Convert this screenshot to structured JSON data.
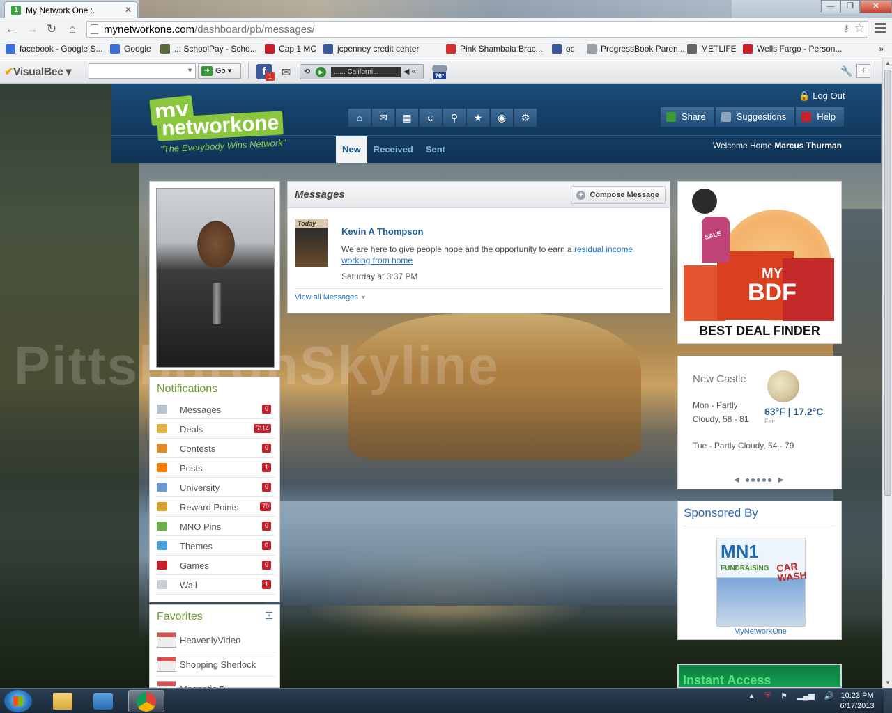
{
  "browser": {
    "tab_title": "My Network One :.",
    "tab_close": "✕",
    "window_controls": {
      "minimize": "—",
      "maximize": "❐",
      "close": "✕"
    },
    "url_host": "mynetworkone.com",
    "url_path": "/dashboard/pb/messages/",
    "nav": {
      "back": "←",
      "forward": "→",
      "reload": "↻",
      "home": "⌂"
    }
  },
  "bookmarks": {
    "items": [
      {
        "label": "facebook - Google S...",
        "icon": "google-icon",
        "color": "#3b6fd6"
      },
      {
        "label": "Google",
        "icon": "google-icon",
        "color": "#3b6fd6"
      },
      {
        "label": ".:: SchoolPay - Scho...",
        "icon": "turtle-icon",
        "color": "#5a6b3a"
      },
      {
        "label": "Cap 1 MC",
        "icon": "capitalone-icon",
        "color": "#c8202a"
      },
      {
        "label": "jcpenney credit center",
        "icon": "facebook-icon",
        "color": "#3b5998"
      },
      {
        "label": "Pink Shambala Brac...",
        "icon": "cart-icon",
        "color": "#d32f2f"
      },
      {
        "label": "oc",
        "icon": "facebook-icon",
        "color": "#3b5998"
      },
      {
        "label": "ProgressBook Paren...",
        "icon": "page-icon",
        "color": "#9aa0a6"
      },
      {
        "label": "METLIFE",
        "icon": "snoopy-icon",
        "color": "#666666"
      },
      {
        "label": "Wells Fargo - Person...",
        "icon": "wellsfargo-icon",
        "color": "#c8202a"
      }
    ],
    "more": "»"
  },
  "toolbar": {
    "brand": "VisualBee",
    "go_label": "Go",
    "fb_badge": "1",
    "station": "...... Californi...",
    "temp": "76°"
  },
  "site": {
    "logo_my": "my",
    "logo_network": "network",
    "logo_one": "one",
    "logo_tagline": "\"The Everybody Wins Network\"",
    "logout": "Log Out",
    "actions": [
      {
        "label": "Share",
        "color": "#3a9a3a"
      },
      {
        "label": "Suggestions",
        "color": "#8aa4bd"
      },
      {
        "label": "Help",
        "color": "#c8202a"
      }
    ],
    "icon_nav": [
      "home-icon",
      "mail-icon",
      "calendar-icon",
      "people-icon",
      "search-icon",
      "star-icon",
      "rss-icon",
      "gear-icon"
    ],
    "icon_glyphs": [
      "⌂",
      "✉",
      "▦",
      "☺",
      "⚲",
      "★",
      "◉",
      "⚙"
    ],
    "tabs": [
      {
        "label": "New",
        "active": true
      },
      {
        "label": "Received",
        "active": false
      },
      {
        "label": "Sent",
        "active": false
      }
    ],
    "welcome_prefix": "Welcome Home ",
    "user_name": "Marcus Thurman"
  },
  "notifications": {
    "title": "Notifications",
    "items": [
      {
        "label": "Messages",
        "count": "0",
        "icon": "envelope-icon",
        "color": "#b9c4d0"
      },
      {
        "label": "Deals",
        "count": "5114",
        "icon": "thumbs-up-icon",
        "color": "#e0b040"
      },
      {
        "label": "Contests",
        "count": "0",
        "icon": "ribbon-icon",
        "color": "#e08a2a"
      },
      {
        "label": "Posts",
        "count": "1",
        "icon": "blogger-icon",
        "color": "#f57d00"
      },
      {
        "label": "University",
        "count": "0",
        "icon": "book-icon",
        "color": "#6a9ad0"
      },
      {
        "label": "Reward Points",
        "count": "70",
        "icon": "coins-icon",
        "color": "#d8a030"
      },
      {
        "label": "MNO Pins",
        "count": "0",
        "icon": "pin-icon",
        "color": "#6ab04c"
      },
      {
        "label": "Themes",
        "count": "0",
        "icon": "themes-icon",
        "color": "#4aa0d8"
      },
      {
        "label": "Games",
        "count": "0",
        "icon": "dice-icon",
        "color": "#c8202a"
      },
      {
        "label": "Wall",
        "count": "1",
        "icon": "speech-bubble-icon",
        "color": "#c9ced3"
      }
    ]
  },
  "favorites": {
    "title": "Favorites",
    "add": "+",
    "items": [
      {
        "label": "HeavenlyVideo"
      },
      {
        "label": "Shopping Sherlock"
      },
      {
        "label": "Magnetic Pl..."
      }
    ]
  },
  "messages": {
    "title": "Messages",
    "compose_label": "Compose Message",
    "item": {
      "sender": "Kevin A Thompson",
      "avatar_text": "Today",
      "body_prefix": "We are here to give people hope and the opportunity to earn a ",
      "link1": "residual income",
      "link2": "working from home",
      "time": "Saturday at 3:37 PM"
    },
    "view_all": "View all Messages"
  },
  "bdf_ad": {
    "my": "MY",
    "bdf": "BDF",
    "sale": "SALE",
    "title": "BEST DEAL FINDER"
  },
  "weather": {
    "city": "New Castle",
    "temp": "63°F | 17.2°C",
    "condition": "Fair",
    "mon": "Mon - Partly Cloudy, 58 - 81",
    "tue": "Tue - Partly Cloudy, 54 - 79",
    "prev": "◀",
    "next": "▶"
  },
  "sponsored": {
    "title": "Sponsored By",
    "img_mn1": "MN1",
    "img_fund": "FUNDRAISING",
    "img_cw": "CAR WASH",
    "caption": "MyNetworkOne"
  },
  "instant": {
    "label": "Instant Access"
  },
  "watermark": "PittsburghSkyline",
  "taskbar": {
    "time": "10:23 PM",
    "date": "6/17/2013"
  }
}
